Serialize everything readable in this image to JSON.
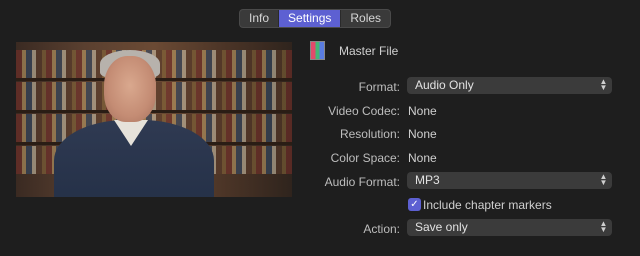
{
  "tabs": [
    {
      "label": "Info",
      "active": false
    },
    {
      "label": "Settings",
      "active": true
    },
    {
      "label": "Roles",
      "active": false
    }
  ],
  "file": {
    "title": "Master File",
    "icon": "film-file-icon"
  },
  "settings": {
    "format": {
      "label": "Format:",
      "value": "Audio Only"
    },
    "video_codec": {
      "label": "Video Codec:",
      "value": "None"
    },
    "resolution": {
      "label": "Resolution:",
      "value": "None"
    },
    "color_space": {
      "label": "Color Space:",
      "value": "None"
    },
    "audio_format": {
      "label": "Audio Format:",
      "value": "MP3"
    },
    "chapter_markers": {
      "label": "Include chapter markers",
      "checked": true
    },
    "action": {
      "label": "Action:",
      "value": "Save only"
    }
  },
  "colors": {
    "accent": "#5d60d2",
    "background": "#1e1e1e",
    "popup": "#3b3b3b"
  }
}
